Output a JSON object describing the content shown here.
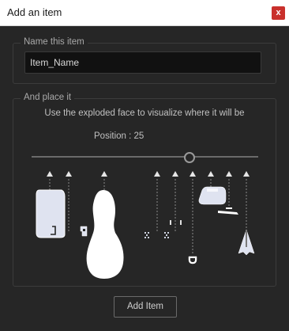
{
  "window": {
    "title": "Add an item",
    "close_glyph": "x"
  },
  "name_section": {
    "label": "Name this item",
    "value": "Item_Name"
  },
  "place_section": {
    "label": "And place it",
    "hint": "Use the exploded face to visualize where it will be",
    "position_label": "Position : 25",
    "position": 25
  },
  "add_button": {
    "label": "Add Item"
  },
  "icons": {
    "marker": "up-triangle-icon"
  },
  "colors": {
    "accent_close": "#c9302c",
    "part_fill": "#dfe3f0"
  }
}
